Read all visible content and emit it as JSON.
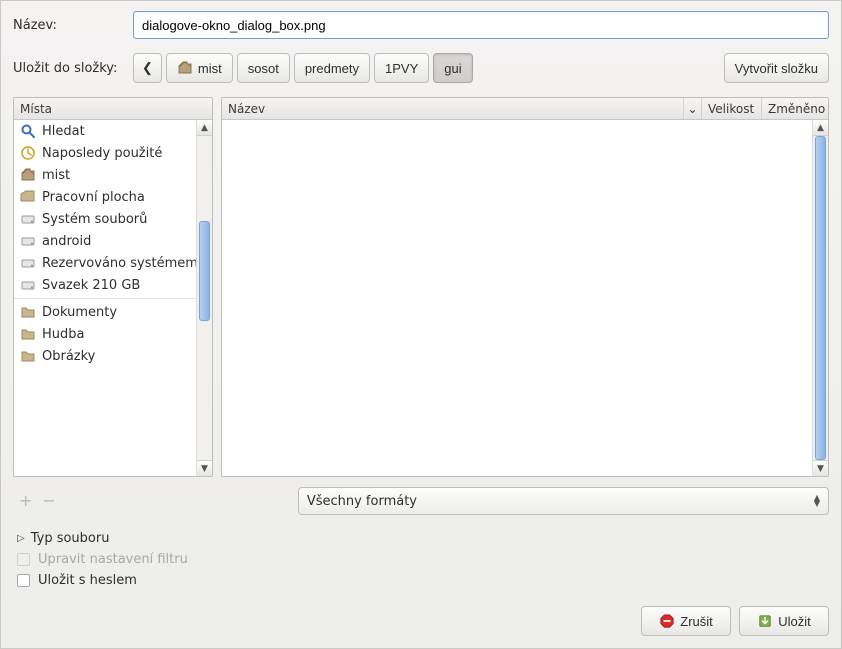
{
  "labels": {
    "name": "Název:",
    "save_in": "Uložit do složky:",
    "create_folder": "Vytvořit složku",
    "places": "Místa",
    "col_name": "Název",
    "col_size": "Velikost",
    "col_modified": "Změněno",
    "all_formats": "Všechny formáty",
    "file_type": "Typ souboru",
    "filter_settings": "Upravit nastavení filtru",
    "save_with_password": "Uložit s heslem",
    "cancel": "Zrušit",
    "save": "Uložit"
  },
  "filename": "dialogove-okno_dialog_box.png",
  "breadcrumbs": {
    "back": "❮",
    "items": [
      {
        "label": "mist",
        "icon": "home"
      },
      {
        "label": "sosot"
      },
      {
        "label": "predmety"
      },
      {
        "label": "1PVY"
      },
      {
        "label": "gui",
        "active": true
      }
    ]
  },
  "places": [
    {
      "label": "Hledat",
      "icon": "search"
    },
    {
      "label": "Naposledy použité",
      "icon": "recent"
    },
    {
      "label": "mist",
      "icon": "home"
    },
    {
      "label": "Pracovní plocha",
      "icon": "desktop"
    },
    {
      "label": "Systém souborů",
      "icon": "drive"
    },
    {
      "label": "android",
      "icon": "drive"
    },
    {
      "label": "Rezervováno systémem",
      "icon": "drive"
    },
    {
      "label": "Svazek 210 GB",
      "icon": "drive"
    },
    {
      "sep": true
    },
    {
      "label": "Dokumenty",
      "icon": "folder"
    },
    {
      "label": "Hudba",
      "icon": "folder"
    },
    {
      "label": "Obrázky",
      "icon": "folder"
    }
  ],
  "checkboxes": {
    "filter_enabled": false,
    "password_enabled": true
  }
}
